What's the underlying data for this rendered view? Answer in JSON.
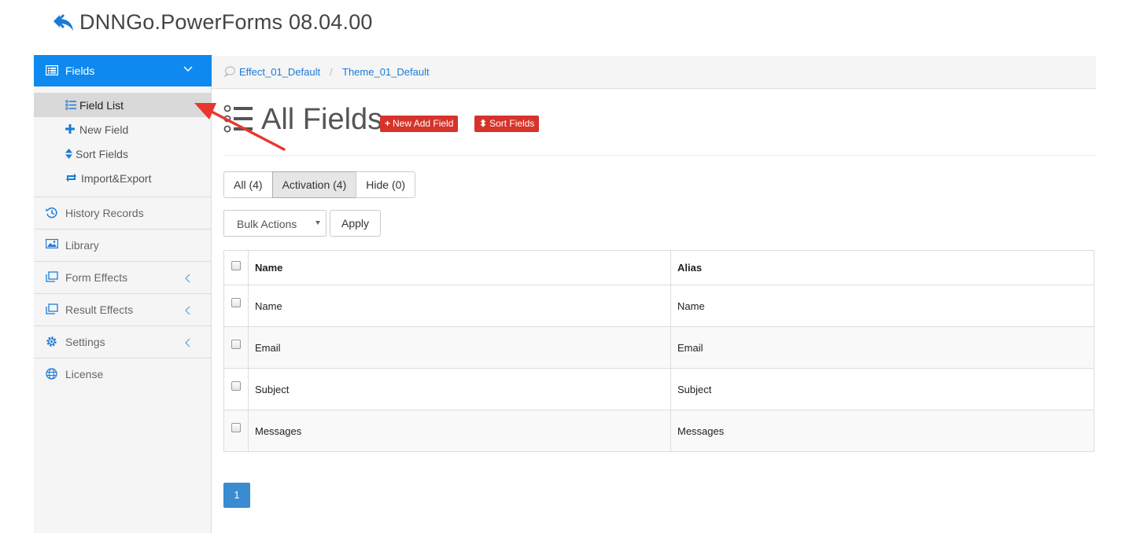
{
  "app": {
    "title": "DNNGo.PowerForms 08.04.00",
    "logo_icon": "reply-arrow-icon",
    "accent": "#0e89ef"
  },
  "sidebar": {
    "main": {
      "label": "Fields",
      "icon": "list-box-icon"
    },
    "subitems": [
      {
        "label": "Field List",
        "icon": "list-icon",
        "active": true
      },
      {
        "label": "New Field",
        "icon": "plus-icon"
      },
      {
        "label": "Sort Fields",
        "icon": "sort-icon"
      },
      {
        "label": "Import&Export",
        "icon": "exchange-icon"
      }
    ],
    "items": [
      {
        "label": "History Records",
        "icon": "history-icon"
      },
      {
        "label": "Library",
        "icon": "image-icon"
      },
      {
        "label": "Form Effects",
        "icon": "clone-icon",
        "has_submenu": true
      },
      {
        "label": "Result Effects",
        "icon": "clone-icon",
        "has_submenu": true
      },
      {
        "label": "Settings",
        "icon": "gear-icon",
        "has_submenu": true
      },
      {
        "label": "License",
        "icon": "globe-icon"
      }
    ]
  },
  "breadcrumb": {
    "items": [
      "Effect_01_Default",
      "Theme_01_Default"
    ],
    "separator": "/"
  },
  "page": {
    "title": "All Fields",
    "actions": [
      {
        "label": "New Add Field",
        "glyph": "+",
        "color": "#d6332b"
      },
      {
        "label": "Sort Fields",
        "glyph": "⬍",
        "color": "#d6332b"
      }
    ]
  },
  "filters": {
    "tabs": [
      "All (4)",
      "Activation (4)",
      "Hide (0)"
    ],
    "active_index": 1
  },
  "bulk": {
    "selected": "Bulk Actions",
    "apply_label": "Apply"
  },
  "table": {
    "columns": [
      "Name",
      "Alias"
    ],
    "rows": [
      [
        "Name",
        "Name"
      ],
      [
        "Email",
        "Email"
      ],
      [
        "Subject",
        "Subject"
      ],
      [
        "Messages",
        "Messages"
      ]
    ]
  },
  "pagination": {
    "current": "1"
  }
}
